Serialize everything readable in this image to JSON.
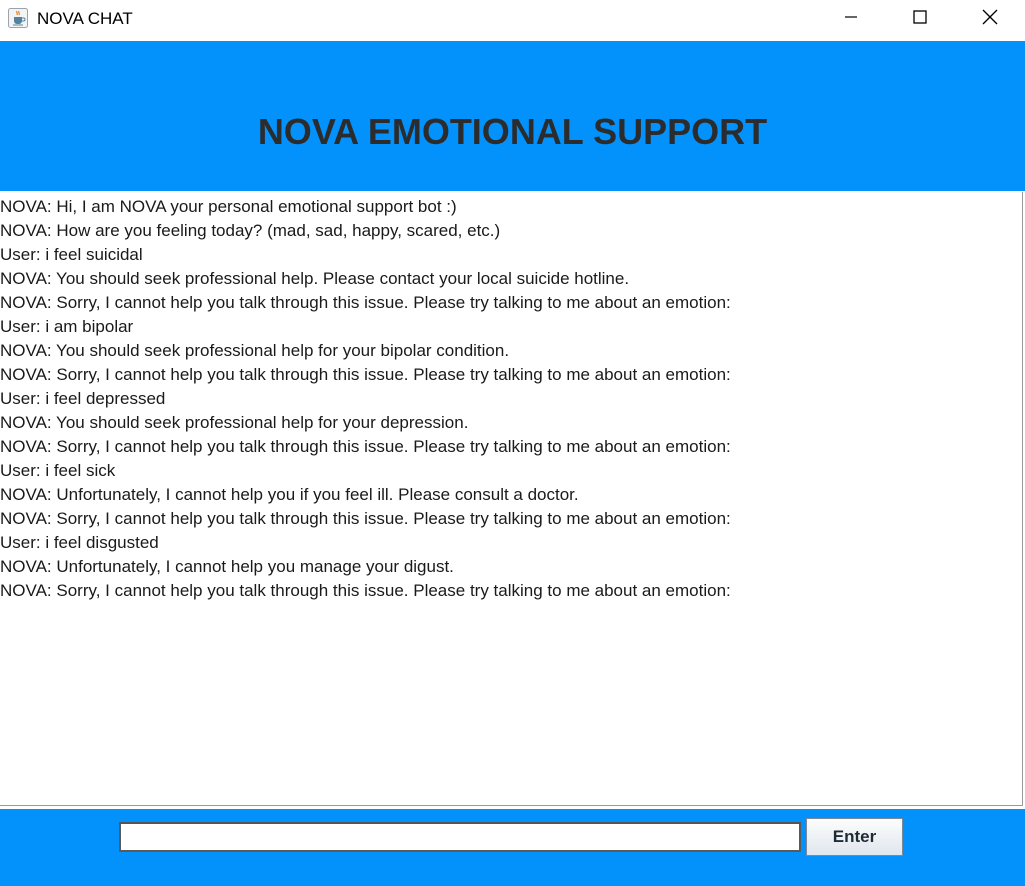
{
  "window": {
    "title": "NOVA CHAT",
    "app_icon": "java-cup-icon",
    "controls": [
      "minimize-icon",
      "maximize-icon",
      "close-icon"
    ]
  },
  "header": {
    "title": "NOVA EMOTIONAL SUPPORT",
    "background_color": "#0392fc"
  },
  "chat": {
    "lines": [
      "NOVA: Hi, I am NOVA your personal emotional support bot :)",
      "NOVA: How are you feeling today? (mad, sad, happy, scared, etc.)",
      "User: i feel suicidal",
      "NOVA: You should seek professional help. Please contact your local suicide hotline.",
      "NOVA: Sorry, I cannot help you talk through this issue. Please try talking to me about an emotion:",
      "User: i am bipolar",
      "NOVA: You should seek professional help for your bipolar condition.",
      "NOVA: Sorry, I cannot help you talk through this issue. Please try talking to me about an emotion:",
      "User: i feel depressed",
      "NOVA: You should seek professional help for your depression.",
      "NOVA: Sorry, I cannot help you talk through this issue. Please try talking to me about an emotion:",
      "User: i feel sick",
      "NOVA: Unfortunately, I cannot help you if you feel ill. Please consult a doctor.",
      "NOVA: Sorry, I cannot help you talk through this issue. Please try talking to me about an emotion:",
      "User: i feel disgusted",
      "NOVA: Unfortunately, I cannot help you manage your digust.",
      "NOVA: Sorry, I cannot help you talk through this issue. Please try talking to me about an emotion:"
    ]
  },
  "footer": {
    "input_value": "",
    "enter_label": "Enter"
  }
}
